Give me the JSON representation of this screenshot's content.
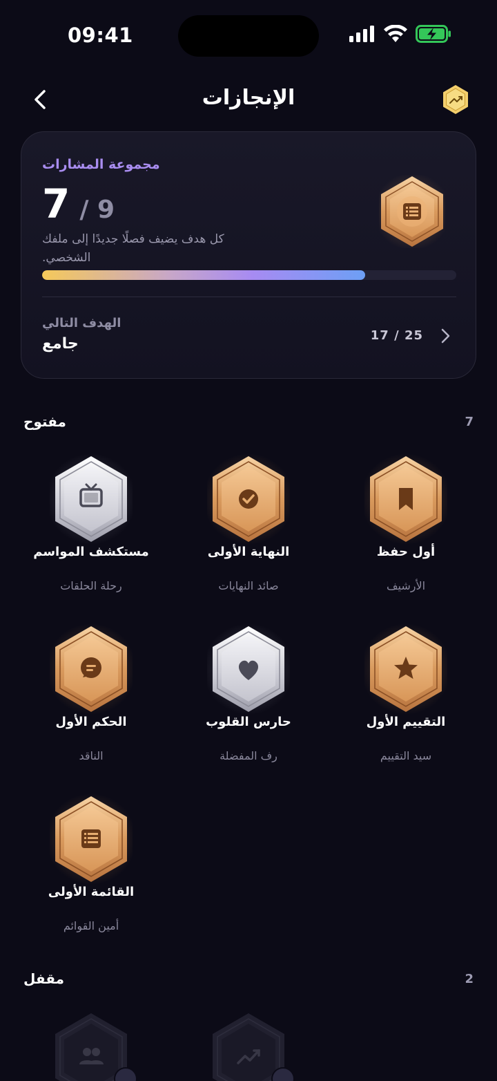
{
  "status": {
    "time": "09:41"
  },
  "header": {
    "title": "الإنجازات"
  },
  "summary": {
    "collection_label": "مجموعة المشارات",
    "count_value": "7",
    "count_total": "/ 9",
    "description": "كل هدف يضيف فصلًا جديدًا إلى ملفك الشخصي.",
    "progress_fraction": 0.78,
    "next_goal_label": "الهدف التالي",
    "next_goal_value": "جامع",
    "next_goal_progress": "17 / 25"
  },
  "unlocked": {
    "title": "مفتوح",
    "count": "7",
    "badges": [
      {
        "name": "مستكشف المواسم",
        "sub": "رحلة الحلقات",
        "icon": "tv-icon",
        "tier": "silver"
      },
      {
        "name": "النهاية الأولى",
        "sub": "صائد النهايات",
        "icon": "check-circle-icon",
        "tier": "gold"
      },
      {
        "name": "أول حفظ",
        "sub": "الأرشيف",
        "icon": "bookmark-icon",
        "tier": "gold"
      },
      {
        "name": "الحكم الأول",
        "sub": "الناقد",
        "icon": "chat-bubble-icon",
        "tier": "gold"
      },
      {
        "name": "حارس القلوب",
        "sub": "رف المفضلة",
        "icon": "heart-icon",
        "tier": "silver"
      },
      {
        "name": "التقييم الأول",
        "sub": "سيد التقييم",
        "icon": "star-icon",
        "tier": "gold"
      },
      {
        "name": "القائمة الأولى",
        "sub": "أمين القوائم",
        "icon": "list-icon",
        "tier": "gold"
      }
    ]
  },
  "locked": {
    "title": "مقفل",
    "count": "2",
    "badges": [
      {
        "icon": "users-icon"
      },
      {
        "icon": "trending-up-icon"
      }
    ]
  },
  "colors": {
    "background": "#0c0b17",
    "accent_purple": "#a98df0",
    "gold": "#e8b277",
    "silver": "#d7d7de"
  }
}
